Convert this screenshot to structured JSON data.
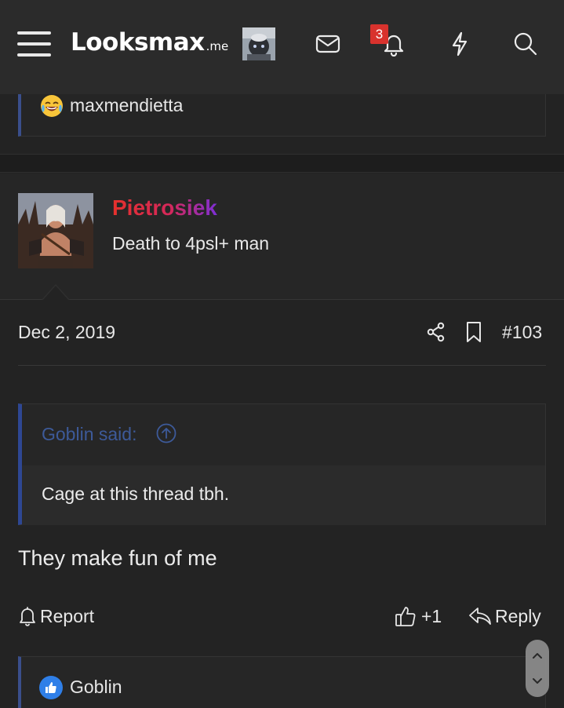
{
  "header": {
    "logo_main": "Looksmax",
    "logo_tld": ".me",
    "notification_count": "3",
    "icons": [
      "menu-icon",
      "mail-icon",
      "bell-icon",
      "bolt-icon",
      "search-icon"
    ]
  },
  "previous_post": {
    "reaction_emoji": "crying-laughing",
    "reactor": "maxmendietta"
  },
  "post": {
    "author": "Pietrosiek",
    "author_title": "Death to 4psl+ man",
    "date": "Dec 2, 2019",
    "number": "#103",
    "quote": {
      "author": "Goblin said:",
      "text": "Cage at this thread tbh."
    },
    "body": "They make fun of me",
    "actions": {
      "report": "Report",
      "like": "+1",
      "reply": "Reply"
    },
    "reactions": {
      "reactor": "Goblin"
    }
  },
  "colors": {
    "background": "#232323",
    "header_bg": "#2b2b2b",
    "quote_accent": "#2e4793",
    "quote_author": "#3d5a99",
    "badge": "#d8322d",
    "username_gradient": [
      "#e6312c",
      "#7d2fd6"
    ]
  }
}
